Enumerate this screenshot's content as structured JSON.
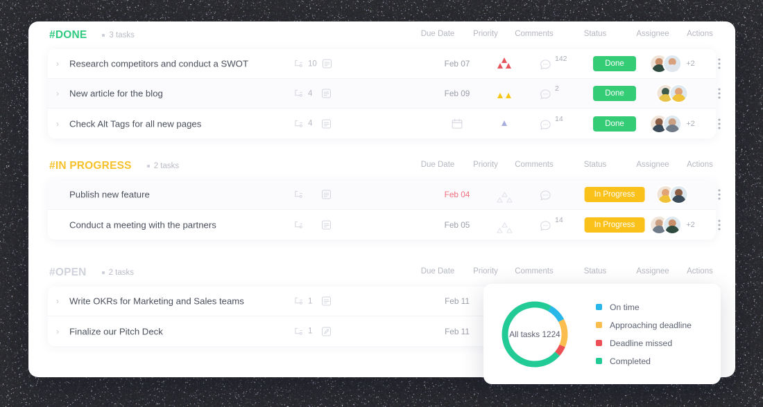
{
  "sections": [
    {
      "id": "done",
      "tag": "#DONE",
      "count_label": "3 tasks",
      "color": "#2fc97f",
      "columns": [
        "Due Date",
        "Priority",
        "Comments",
        "Status",
        "Assignee",
        "Actions"
      ],
      "tasks": [
        {
          "title": "Research competitors and conduct a SWOT",
          "chevron": "›",
          "subtasks": "10",
          "has_description": true,
          "description_icon": "description-icon",
          "due_date": "Feb 07",
          "due_overdue": false,
          "priority": "high",
          "comments": "142",
          "status": "Done",
          "status_kind": "done",
          "avatars": 2,
          "more": "+2",
          "highlight": false
        },
        {
          "title": "New article for the blog",
          "chevron": "›",
          "subtasks": "4",
          "has_description": true,
          "description_icon": "description-icon",
          "due_date": "Feb 09",
          "due_overdue": false,
          "priority": "medium",
          "comments": "2",
          "status": "Done",
          "status_kind": "done",
          "avatars": 2,
          "more": "",
          "highlight": true
        },
        {
          "title": "Check Alt Tags for all new pages",
          "chevron": "›",
          "subtasks": "4",
          "has_description": true,
          "description_icon": "description-icon",
          "due_date": "",
          "due_overdue": false,
          "priority": "low",
          "comments": "14",
          "status": "Done",
          "status_kind": "done",
          "avatars": 2,
          "more": "+2",
          "highlight": false
        }
      ]
    },
    {
      "id": "progress",
      "tag": "#IN PROGRESS",
      "count_label": "2 tasks",
      "color": "#f7c12b",
      "columns": [
        "Due Date",
        "Priority",
        "Comments",
        "Status",
        "Assignee",
        "Actions"
      ],
      "tasks": [
        {
          "title": "Publish new feature",
          "chevron": "",
          "subtasks": "",
          "has_description": true,
          "description_icon": "description-icon",
          "due_date": "Feb 04",
          "due_overdue": true,
          "priority": "none",
          "comments": "",
          "status": "In Progress",
          "status_kind": "progress",
          "avatars": 2,
          "more": "",
          "highlight": true
        },
        {
          "title": "Conduct a meeting with the partners",
          "chevron": "",
          "subtasks": "",
          "has_description": true,
          "description_icon": "description-icon",
          "due_date": "Feb 05",
          "due_overdue": false,
          "priority": "none",
          "comments": "14",
          "status": "In Progress",
          "status_kind": "progress",
          "avatars": 2,
          "more": "+2",
          "highlight": false
        }
      ]
    },
    {
      "id": "open",
      "tag": "#OPEN",
      "count_label": "2 tasks",
      "color": "#cfd2da",
      "columns": [
        "Due Date",
        "Priority",
        "Comments",
        "Status",
        "Assignee",
        "Actions"
      ],
      "tasks": [
        {
          "title": "Write OKRs for Marketing and Sales teams",
          "chevron": "›",
          "subtasks": "1",
          "has_description": true,
          "description_icon": "description-icon",
          "due_date": "Feb 11",
          "due_overdue": false,
          "priority": "none",
          "comments": "",
          "status": "",
          "status_kind": "",
          "avatars": 0,
          "more": "",
          "highlight": false
        },
        {
          "title": "Finalize our Pitch Deck",
          "chevron": "›",
          "subtasks": "1",
          "has_description": true,
          "description_icon": "edit-icon",
          "due_date": "Feb 11",
          "due_overdue": false,
          "priority": "none",
          "comments": "",
          "status": "",
          "status_kind": "",
          "avatars": 0,
          "more": "",
          "highlight": false
        }
      ]
    }
  ],
  "chart_card": {
    "center_label": "All tasks 1224",
    "legend": [
      {
        "label": "On time",
        "color": "#29b6e8"
      },
      {
        "label": "Approaching deadline",
        "color": "#fbbe4e"
      },
      {
        "label": "Deadline missed",
        "color": "#ec4f54"
      },
      {
        "label": "Completed",
        "color": "#22cb95"
      }
    ]
  },
  "chart_data": {
    "type": "pie",
    "variant": "donut",
    "title": "All tasks 1224",
    "total": 1224,
    "categories": [
      "On time",
      "Approaching deadline",
      "Deadline missed",
      "Completed"
    ],
    "values": [
      9,
      14,
      5,
      72
    ],
    "value_unit": "percent",
    "colors": [
      "#29b6e8",
      "#fbbe4e",
      "#ec4f54",
      "#22cb95"
    ],
    "legend_position": "right",
    "grid": false,
    "start_angle_deg": -60,
    "direction": "clockwise"
  },
  "avatar_palette": [
    {
      "head": "#c98f6a",
      "body": "#2f4a3f"
    },
    {
      "head": "#d8a07c",
      "body": "#dfe6ee"
    },
    {
      "head": "#3f5a4b",
      "body": "#e7c34a"
    },
    {
      "head": "#e0a477",
      "body": "#f0c23a"
    },
    {
      "head": "#8b5f45",
      "body": "#3b4a58"
    },
    {
      "head": "#caa084",
      "body": "#6f7b88"
    }
  ]
}
